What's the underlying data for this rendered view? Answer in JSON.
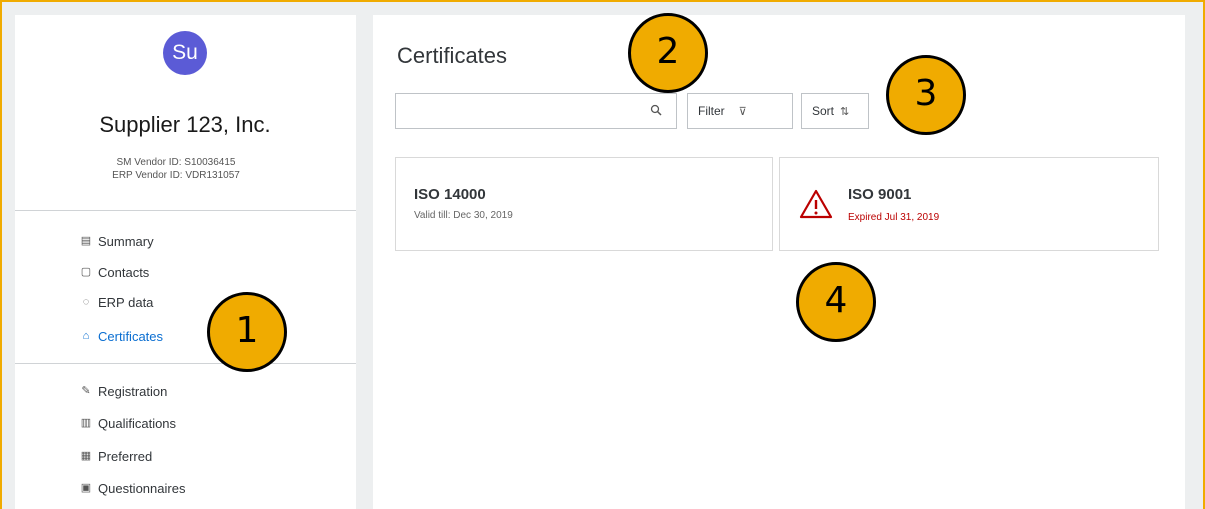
{
  "profile": {
    "avatar_initials": "Su",
    "avatar_color": "#5b5bd6",
    "supplier_name": "Supplier 123, Inc.",
    "sm_vendor_id": "SM Vendor ID:  S10036415",
    "erp_vendor_id": "ERP Vendor ID:  VDR131057"
  },
  "sidebar": {
    "items": [
      {
        "label": "Summary",
        "icon": "summary-icon"
      },
      {
        "label": "Contacts",
        "icon": "contacts-icon"
      },
      {
        "label": "ERP data",
        "icon": "erp-data-icon"
      },
      {
        "label": "Certificates",
        "icon": "certificates-icon",
        "active": true
      },
      {
        "label": "Registration",
        "icon": "registration-icon"
      },
      {
        "label": "Qualifications",
        "icon": "qualifications-icon"
      },
      {
        "label": "Preferred",
        "icon": "preferred-icon"
      },
      {
        "label": "Questionnaires",
        "icon": "questionnaires-icon"
      }
    ],
    "active_color": "#0a6ed1"
  },
  "main": {
    "title": "Certificates",
    "search": {
      "value": "",
      "placeholder": ""
    },
    "filter_label": "Filter",
    "sort_label": "Sort",
    "certificates": [
      {
        "name": "ISO 14000",
        "status": "Valid till: Dec 30, 2019",
        "status_color": "#666666",
        "warning": false
      },
      {
        "name": "ISO 9001",
        "status": "Expired Jul 31, 2019",
        "status_color": "#bb0000",
        "warning": true
      }
    ]
  },
  "callouts": [
    "1",
    "2",
    "3",
    "4"
  ],
  "colors": {
    "callout": "#f0ab00",
    "frame": "#f0ab00",
    "warning": "#bb0000"
  }
}
